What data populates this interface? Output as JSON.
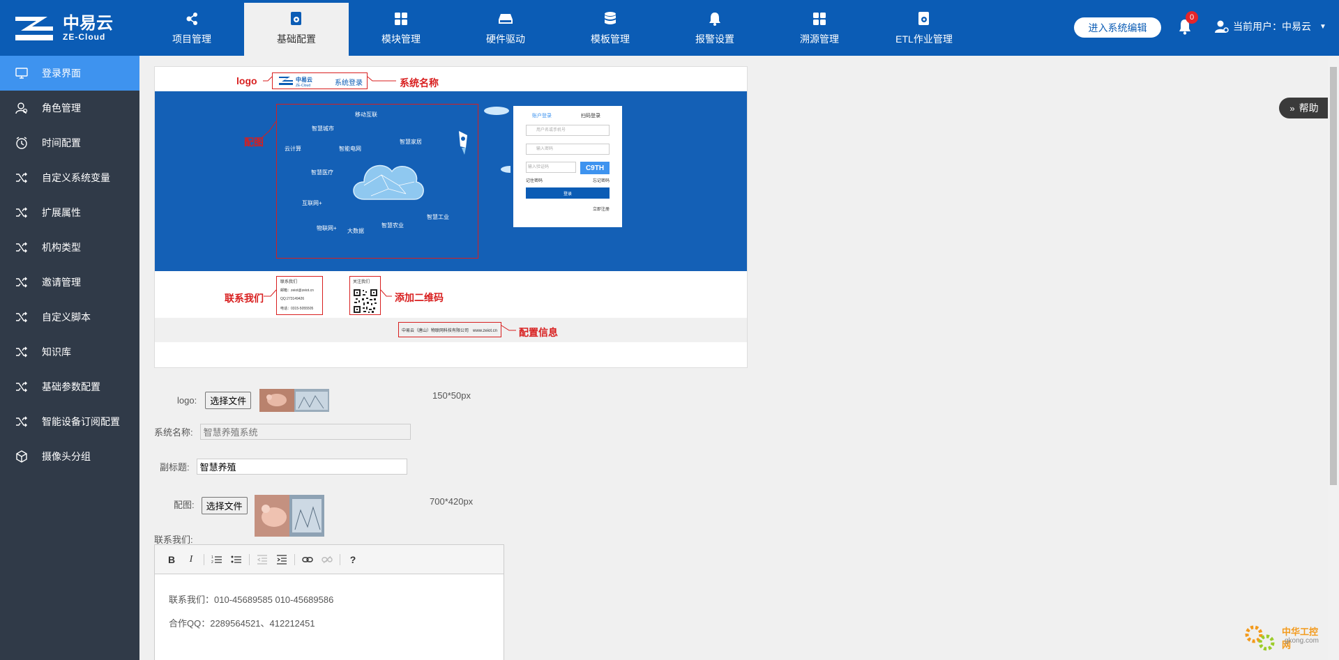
{
  "brand": {
    "name_cn": "中易云",
    "name_en": "ZE-Cloud"
  },
  "nav": {
    "tabs": [
      {
        "label": "项目管理",
        "icon": "share-nodes-icon"
      },
      {
        "label": "基础配置",
        "icon": "config-doc-icon",
        "active": true
      },
      {
        "label": "模块管理",
        "icon": "modules-icon"
      },
      {
        "label": "硬件驱动",
        "icon": "hard-drive-icon"
      },
      {
        "label": "模板管理",
        "icon": "database-icon"
      },
      {
        "label": "报警设置",
        "icon": "bell-icon"
      },
      {
        "label": "溯源管理",
        "icon": "grid-icon"
      },
      {
        "label": "ETL作业管理",
        "icon": "job-config-icon"
      }
    ],
    "enter_button": "进入系统编辑",
    "notification_count": "0",
    "current_user": "当前用户：中易云"
  },
  "sidebar": {
    "items": [
      {
        "label": "登录界面",
        "icon": "monitor-icon",
        "active": true
      },
      {
        "label": "角色管理",
        "icon": "user-role-icon"
      },
      {
        "label": "时间配置",
        "icon": "alarm-clock-icon"
      },
      {
        "label": "自定义系统变量",
        "icon": "shuffle-icon"
      },
      {
        "label": "扩展属性",
        "icon": "shuffle-icon"
      },
      {
        "label": "机构类型",
        "icon": "shuffle-icon"
      },
      {
        "label": "邀请管理",
        "icon": "shuffle-icon"
      },
      {
        "label": "自定义脚本",
        "icon": "shuffle-icon"
      },
      {
        "label": "知识库",
        "icon": "shuffle-icon"
      },
      {
        "label": "基础参数配置",
        "icon": "shuffle-icon"
      },
      {
        "label": "智能设备订阅配置",
        "icon": "shuffle-icon"
      },
      {
        "label": "摄像头分组",
        "icon": "cube-icon"
      }
    ]
  },
  "preview": {
    "labels": {
      "logo": "logo",
      "system_name": "系统名称",
      "image": "配图",
      "contact": "联系我们",
      "qr": "添加二维码",
      "config_info": "配置信息"
    },
    "header_system_login": "系统登录",
    "cloud_words": [
      "移动互联",
      "智慧城市",
      "云计算",
      "智能电网",
      "智慧家居",
      "智慧医疗",
      "互联网+",
      "物联网+",
      "大数据",
      "智慧农业",
      "智慧工业"
    ],
    "login_card": {
      "tab_account": "账户登录",
      "tab_scan": "扫码登录",
      "user_placeholder": "用户名或手机号",
      "password_placeholder": "输入密码",
      "captcha_placeholder": "输入验证码",
      "captcha": "C9TH",
      "remember": "记住密码",
      "forgot": "忘记密码",
      "login_button": "登录",
      "register": "立即注册"
    },
    "contact_box": {
      "title": "联系我们",
      "email": "邮箱：zeiot@zeiot.cn",
      "qq": "QQ:273149426",
      "phone": "电话：0315-5055505"
    },
    "qr_box_title": "关注我们",
    "footer_text": "中易云（唐山）物联网科技有限公司　www.zeiot.cn"
  },
  "form": {
    "logo_label": "logo:",
    "choose_file": "选择文件",
    "logo_size": "150*50px",
    "system_name_label": "系统名称:",
    "system_name_value": "智慧养殖系统",
    "subtitle_label": "副标题:",
    "subtitle_value": "智慧养殖",
    "image_label": "配图:",
    "image_size": "700*420px",
    "contact_label": "联系我们:"
  },
  "editor": {
    "tools": [
      "B",
      "I",
      "ordered-list-icon",
      "unordered-list-icon",
      "outdent-icon",
      "indent-icon",
      "link-icon",
      "unlink-icon",
      "?"
    ],
    "line1": "联系我们：010-45689585 010-45689586",
    "line2": "合作QQ：2289564521、412212451"
  },
  "help_label": "帮助",
  "watermark": {
    "name": "中华工控网",
    "domain": "gkong.com"
  },
  "colors": {
    "primary": "#0b5cb5",
    "sidebar": "#303a48",
    "sidebar_active": "#3e93ef",
    "annotation": "#d81e1e",
    "badge": "#e4252a"
  }
}
